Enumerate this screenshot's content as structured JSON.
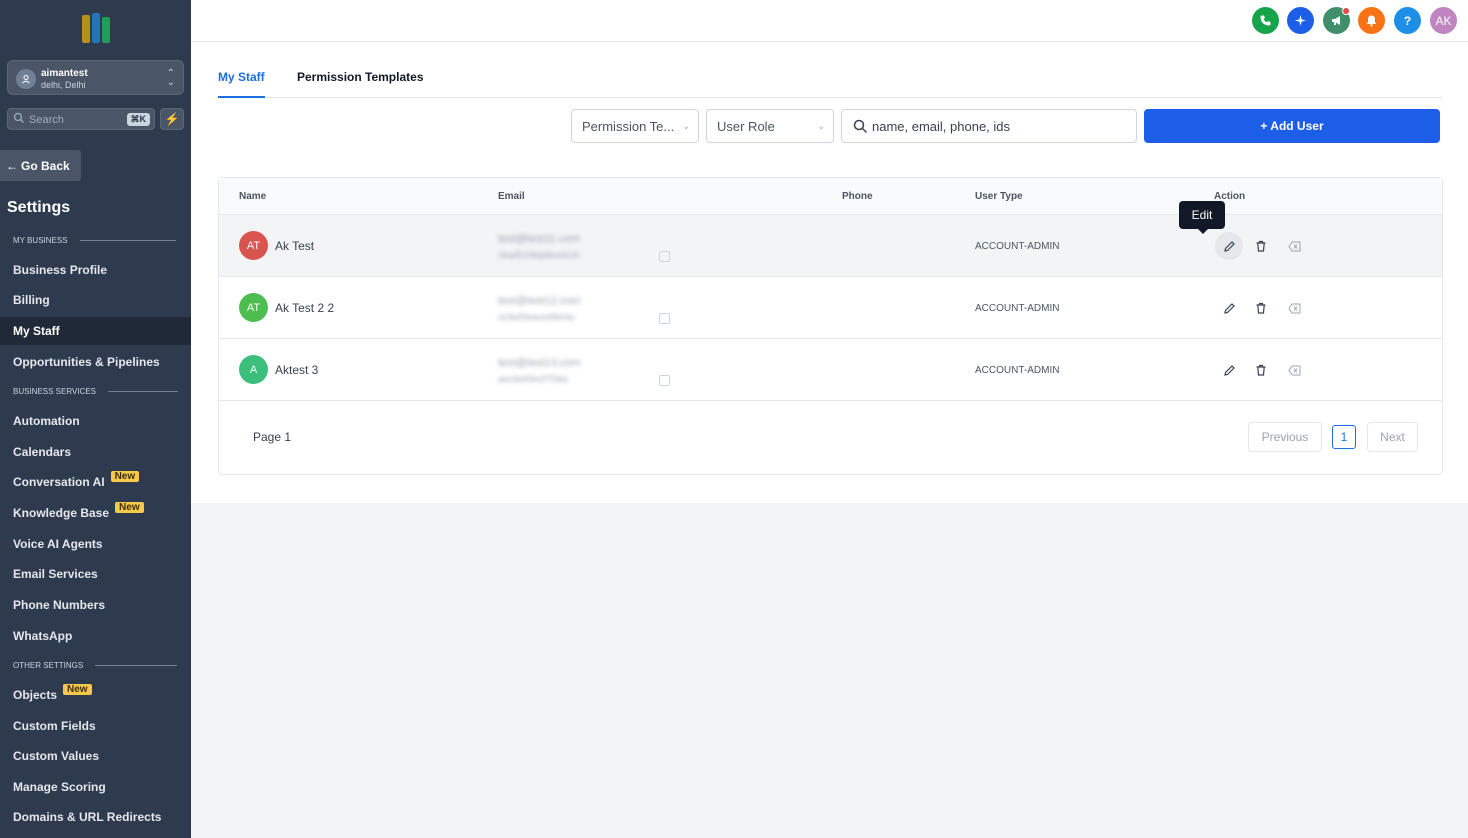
{
  "sidebar": {
    "account": {
      "name": "aimantest",
      "location": "delhi, Delhi"
    },
    "search": {
      "placeholder": "Search",
      "shortcut": "⌘K"
    },
    "go_back": "Go Back",
    "title": "Settings",
    "sections": [
      {
        "label": "MY BUSINESS"
      },
      {
        "label": "BUSINESS SERVICES"
      },
      {
        "label": "OTHER SETTINGS"
      }
    ],
    "items": [
      {
        "label": "Business Profile"
      },
      {
        "label": "Billing"
      },
      {
        "label": "My Staff",
        "active": true
      },
      {
        "label": "Opportunities & Pipelines"
      },
      {
        "label": "Automation"
      },
      {
        "label": "Calendars"
      },
      {
        "label": "Conversation AI",
        "badge": "New"
      },
      {
        "label": "Knowledge Base",
        "badge": "New"
      },
      {
        "label": "Voice AI Agents"
      },
      {
        "label": "Email Services"
      },
      {
        "label": "Phone Numbers"
      },
      {
        "label": "WhatsApp"
      },
      {
        "label": "Objects",
        "badge": "New"
      },
      {
        "label": "Custom Fields"
      },
      {
        "label": "Custom Values"
      },
      {
        "label": "Manage Scoring"
      },
      {
        "label": "Domains & URL Redirects"
      }
    ]
  },
  "topbar": {
    "icons": [
      {
        "name": "phone-icon",
        "color": "#16a34a"
      },
      {
        "name": "sparkle-icon",
        "color": "#1d5ee8"
      },
      {
        "name": "megaphone-icon",
        "color": "#3f8f6b"
      },
      {
        "name": "bell-icon",
        "color": "#f97316"
      },
      {
        "name": "help-icon",
        "color": "#1d8fe8"
      }
    ],
    "help_glyph": "?",
    "user_initials": "AK",
    "user_color": "#c084c0"
  },
  "tabs": [
    {
      "label": "My Staff",
      "active": true
    },
    {
      "label": "Permission Templates"
    }
  ],
  "filters": {
    "permission_template": "Permission Te...",
    "user_role": "User Role",
    "search_placeholder": "name, email, phone, ids",
    "add_user": "+ Add User"
  },
  "table": {
    "headers": [
      "Name",
      "Email",
      "Phone",
      "User Type",
      "Action"
    ],
    "rows": [
      {
        "initials": "AT",
        "name": "Ak Test",
        "avatar_color": "#d9534f",
        "email": "test@test11.com",
        "id": "nbq4510ttq0buxt1zh",
        "user_type": "ACCOUNT-ADMIN"
      },
      {
        "initials": "AT",
        "name": "Ak Test 2 2",
        "avatar_color": "#4ebd50",
        "email": "test@test12.com",
        "id": "nc9wf3eauvs5kmiu",
        "user_type": "ACCOUNT-ADMIN"
      },
      {
        "initials": "A",
        "name": "Aktest 3",
        "avatar_color": "#3cbf7a",
        "email": "test@test13.com",
        "id": "asn3s40kvrf7f3ez",
        "user_type": "ACCOUNT-ADMIN"
      }
    ],
    "tooltip": "Edit"
  },
  "pagination": {
    "label": "Page 1",
    "previous": "Previous",
    "current": "1",
    "next": "Next"
  }
}
